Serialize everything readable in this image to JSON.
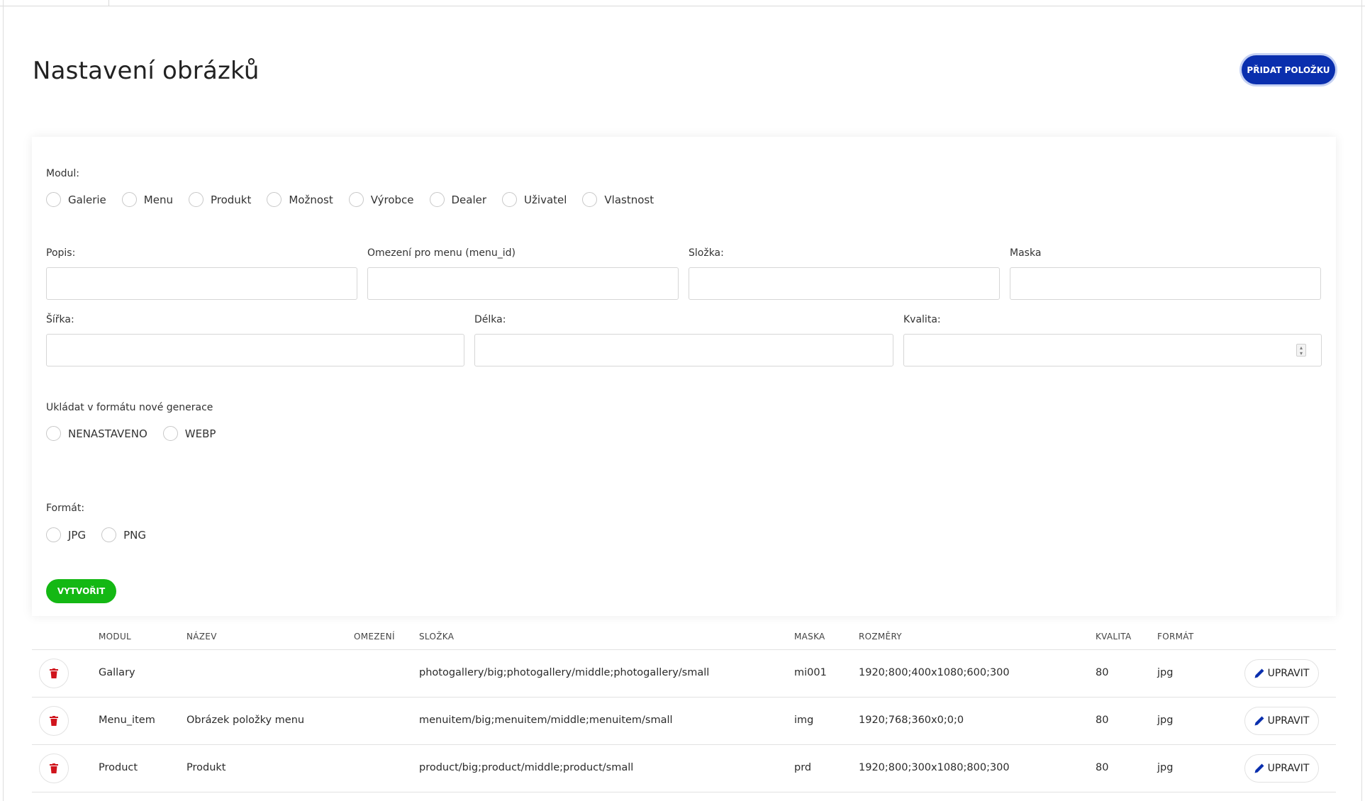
{
  "page": {
    "title": "Nastavení obrázků",
    "add_label": "PŘIDAT POLOŽKU"
  },
  "form": {
    "modul_label": "Modul:",
    "modules": [
      "Galerie",
      "Menu",
      "Produkt",
      "Možnost",
      "Výrobce",
      "Dealer",
      "Uživatel",
      "Vlastnost"
    ],
    "popis_label": "Popis:",
    "omezeni_label": "Omezení pro menu (menu_id)",
    "slozka_label": "Složka:",
    "maska_label": "Maska",
    "sirka_label": "Šířka:",
    "delka_label": "Délka:",
    "kvalita_label": "Kvalita:",
    "next_gen_label": "Ukládat v formátu nové generace",
    "next_gen_options": [
      "NENASTAVENO",
      "WEBP"
    ],
    "format_label": "Formát:",
    "format_options": [
      "JPG",
      "PNG"
    ],
    "create_label": "VYTVOŘIT"
  },
  "table": {
    "headers": [
      "MODUL",
      "NÁZEV",
      "OMEZENÍ",
      "SLOŽKA",
      "MASKA",
      "ROZMĚRY",
      "KVALITA",
      "FORMÁT"
    ],
    "edit_label": "UPRAVIT",
    "rows": [
      {
        "modul": "Gallary",
        "nazev": "",
        "omezeni": "",
        "slozka": "photogallery/big;photogallery/middle;photogallery/small",
        "maska": "mi001",
        "rozmery": "1920;800;400x1080;600;300",
        "kvalita": "80",
        "format": "jpg"
      },
      {
        "modul": "Menu_item",
        "nazev": "Obrázek položky menu",
        "omezeni": "",
        "slozka": "menuitem/big;menuitem/middle;menuitem/small",
        "maska": "img",
        "rozmery": "1920;768;360x0;0;0",
        "kvalita": "80",
        "format": "jpg"
      },
      {
        "modul": "Product",
        "nazev": "Produkt",
        "omezeni": "",
        "slozka": "product/big;product/middle;product/small",
        "maska": "prd",
        "rozmery": "1920;800;300x1080;800;300",
        "kvalita": "80",
        "format": "jpg"
      }
    ]
  },
  "colors": {
    "primary": "#0a2fae",
    "success": "#14b814",
    "danger": "#d0141c"
  }
}
